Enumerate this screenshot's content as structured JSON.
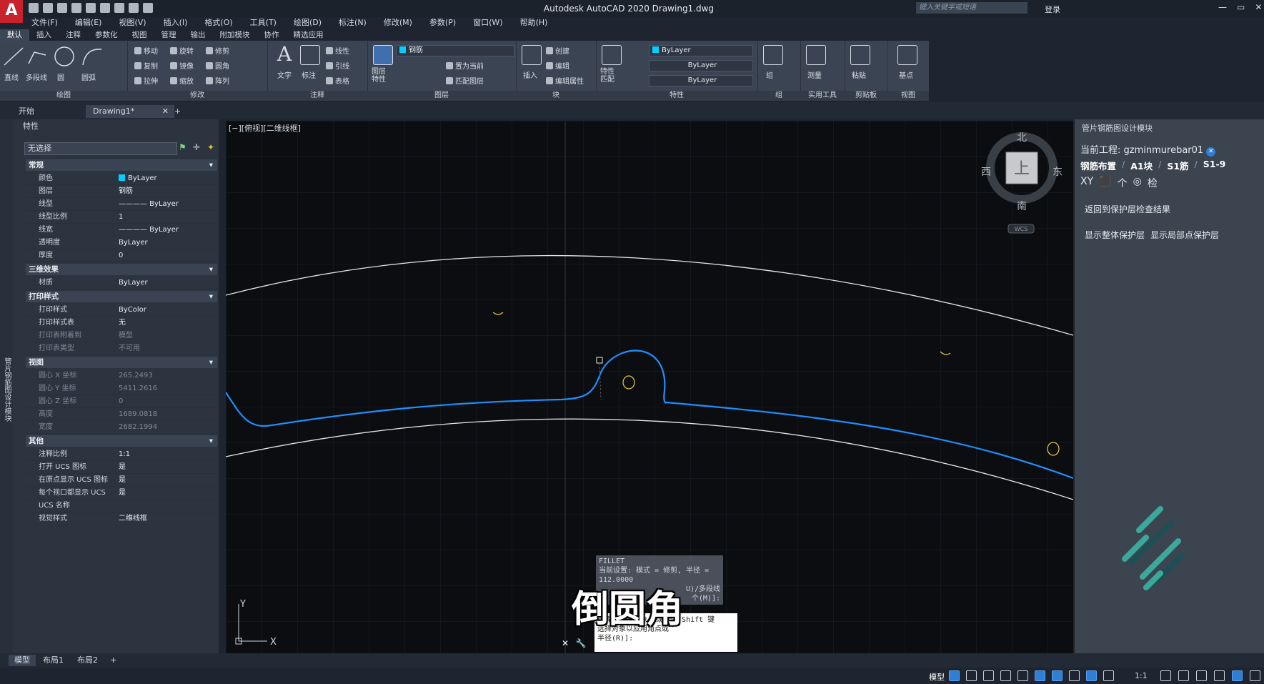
{
  "app": {
    "title": "Autodesk AutoCAD 2020    Drawing1.dwg",
    "logo_letter": "A",
    "search_placeholder": "键入关键字或短语",
    "login": "登录"
  },
  "menu": [
    "文件(F)",
    "编辑(E)",
    "视图(V)",
    "插入(I)",
    "格式(O)",
    "工具(T)",
    "绘图(D)",
    "标注(N)",
    "修改(M)",
    "参数(P)",
    "窗口(W)",
    "帮助(H)"
  ],
  "ribbon_tabs": [
    "默认",
    "插入",
    "注释",
    "参数化",
    "视图",
    "管理",
    "输出",
    "附加模块",
    "协作",
    "精选应用"
  ],
  "ribbon": {
    "draw": {
      "title": "绘图",
      "line": "直线",
      "polyline": "多段线",
      "circle": "圆",
      "arc": "圆弧"
    },
    "modify": {
      "title": "修改",
      "move": "移动",
      "rotate": "旋转",
      "trim": "修剪",
      "copy": "复制",
      "mirror": "镜像",
      "fillet": "圆角",
      "stretch": "拉伸",
      "scale": "缩放",
      "array": "阵列"
    },
    "annotation": {
      "title": "注释",
      "text": "文字",
      "dimension": "标注",
      "linear": "线性",
      "leader": "引线",
      "table": "表格"
    },
    "layers": {
      "title": "图层",
      "layer_props": "图层\n特性",
      "layer_name": "钢筋",
      "set_current": "置为当前",
      "match_layer": "匹配图层"
    },
    "block": {
      "title": "块",
      "insert": "插入",
      "create": "创建",
      "edit": "编辑",
      "edit_attr": "编辑属性"
    },
    "properties": {
      "title": "特性",
      "match": "特性\n匹配",
      "color": "ByLayer",
      "linetype": "ByLayer",
      "lineweight": "ByLayer"
    },
    "groups": {
      "title": "组",
      "group": "组"
    },
    "utilities": {
      "title": "实用工具",
      "measure": "测量"
    },
    "clipboard": {
      "title": "剪贴板",
      "paste": "粘贴"
    },
    "view": {
      "title": "视图",
      "base": "基点"
    }
  },
  "doc_tabs": {
    "start": "开始",
    "drawing": "Drawing1*"
  },
  "properties_palette": {
    "header": "特性",
    "side_label": "管片钢筋图设计模块",
    "selection": "无选择",
    "sections": [
      {
        "title": "常规",
        "rows": [
          {
            "k": "颜色",
            "v": "ByLayer"
          },
          {
            "k": "图层",
            "v": "钢筋"
          },
          {
            "k": "线型",
            "v": "———— ByLayer"
          },
          {
            "k": "线型比例",
            "v": "1"
          },
          {
            "k": "线宽",
            "v": "———— ByLayer"
          },
          {
            "k": "透明度",
            "v": "ByLayer"
          },
          {
            "k": "厚度",
            "v": "0"
          }
        ]
      },
      {
        "title": "三维效果",
        "rows": [
          {
            "k": "材质",
            "v": "ByLayer"
          }
        ]
      },
      {
        "title": "打印样式",
        "rows": [
          {
            "k": "打印样式",
            "v": "ByColor"
          },
          {
            "k": "打印样式表",
            "v": "无"
          },
          {
            "k": "打印表附着到",
            "v": "模型"
          },
          {
            "k": "打印表类型",
            "v": "不可用"
          }
        ]
      },
      {
        "title": "视图",
        "rows": [
          {
            "k": "圆心 X 坐标",
            "v": "265.2493"
          },
          {
            "k": "圆心 Y 坐标",
            "v": "5411.2616"
          },
          {
            "k": "圆心 Z 坐标",
            "v": "0"
          },
          {
            "k": "高度",
            "v": "1689.0818"
          },
          {
            "k": "宽度",
            "v": "2682.1994"
          }
        ]
      },
      {
        "title": "其他",
        "rows": [
          {
            "k": "注释比例",
            "v": "1:1"
          },
          {
            "k": "打开 UCS 图标",
            "v": "是"
          },
          {
            "k": "在原点显示 UCS 图标",
            "v": "是"
          },
          {
            "k": "每个视口都显示 UCS",
            "v": "是"
          },
          {
            "k": "UCS 名称",
            "v": ""
          },
          {
            "k": "视觉样式",
            "v": "二维线框"
          }
        ]
      }
    ]
  },
  "viewport": {
    "label": "[−][俯视][二维线框]",
    "viewcube": {
      "north": "北",
      "south": "南",
      "east": "东",
      "west": "西",
      "top": "上",
      "wcs": "WCS"
    },
    "ucs_x": "X",
    "ucs_y": "Y"
  },
  "right_panel": {
    "title": "管片钢筋图设计模块",
    "project_label": "当前工程:",
    "project_name": "gzminmurebar01",
    "crumbs": [
      "钢筋布置",
      "A1块",
      "S1筋",
      "S1-9"
    ],
    "tools": [
      "XY",
      "⬛",
      "个",
      "◎",
      "检"
    ],
    "btn_return": "返回到保护层检查结果",
    "btn_show_all": "显示整体保护层",
    "btn_show_local": "显示局部点保护层"
  },
  "command": {
    "history": [
      "FILLET",
      "当前设置: 模式 = 修剪, 半径 =",
      "112.0000",
      "U)/多段线",
      "个(M)]:"
    ],
    "prompt": [
      "选择第二个对象, 或按住 Shift 键",
      "选择对象以应用角点或",
      "半径(R)]:"
    ]
  },
  "subtitle": "倒圆角",
  "layout_tabs": [
    "模型",
    "布局1",
    "布局2"
  ],
  "status": {
    "model": "模型",
    "scale": "1:1"
  },
  "colors": {
    "accent": "#2f7fd6",
    "rebar": "#1e8fff",
    "layer_swatch": "#00cfff",
    "outline": "#e6e6e6",
    "marker": "#e0c040"
  }
}
